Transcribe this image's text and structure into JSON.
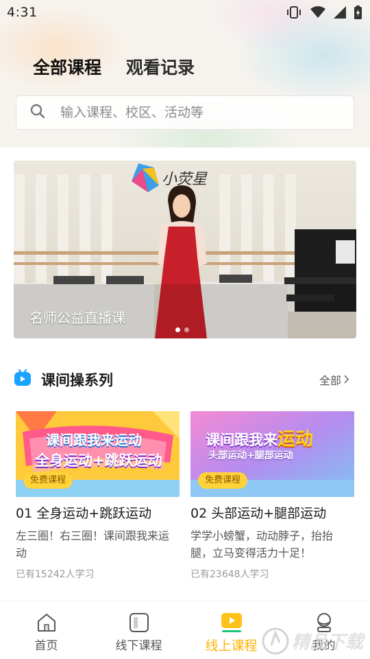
{
  "status_bar": {
    "time": "4:31"
  },
  "tabs": [
    {
      "label": "全部课程",
      "active": true
    },
    {
      "label": "观看记录",
      "active": false
    }
  ],
  "search": {
    "placeholder": "输入课程、校区、活动等"
  },
  "banner": {
    "title": "名师公益直播课",
    "logo_text": "小荧星",
    "slide_count": 2,
    "active_slide": 0
  },
  "section": {
    "title": "课间操系列",
    "more_label": "全部",
    "icon": "tv-icon"
  },
  "courses": [
    {
      "thumb_line1": "课间跟我来运动",
      "thumb_line2": "全身运动+跳跃运动",
      "badge": "免费课程",
      "title": "01 全身运动+跳跃运动",
      "desc": "左三圈！右三圈！课间跟我来运动",
      "count": "已有15242人学习"
    },
    {
      "thumb_line1": "课间跟我来",
      "thumb_line1_highlight": "运动",
      "thumb_line2": "头部运动+腿部运动",
      "badge": "免费课程",
      "title": "02 头部运动+腿部运动",
      "desc": "学学小螃蟹，动动脖子，抬抬腿，立马变得活力十足！",
      "count": "已有23648人学习"
    }
  ],
  "bottom_nav": [
    {
      "label": "首页",
      "icon": "home-icon",
      "active": false
    },
    {
      "label": "线下课程",
      "icon": "book-icon",
      "active": false
    },
    {
      "label": "线上课程",
      "icon": "play-screen-icon",
      "active": true
    },
    {
      "label": "我的",
      "icon": "profile-icon",
      "active": false
    }
  ],
  "colors": {
    "accent": "#ffc21a",
    "active_nav": "#ffb300",
    "section_icon": "#1aa3ff"
  }
}
